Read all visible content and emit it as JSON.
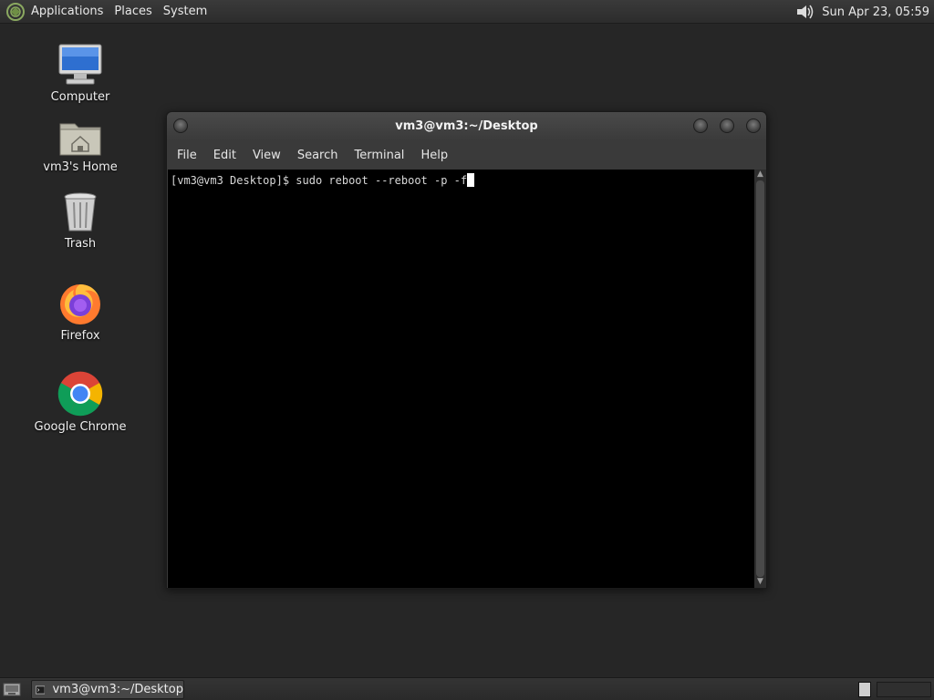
{
  "top_panel": {
    "menus": [
      "Applications",
      "Places",
      "System"
    ],
    "clock": "Sun Apr 23, 05:59",
    "icons": {
      "logo": "distro-logo-icon",
      "volume": "speaker-icon"
    }
  },
  "desktop": {
    "icons": [
      {
        "label": "Computer",
        "icon": "computer-icon"
      },
      {
        "label": "vm3's Home",
        "icon": "home-folder-icon"
      },
      {
        "label": "Trash",
        "icon": "trash-icon"
      },
      {
        "label": "Firefox",
        "icon": "firefox-icon"
      },
      {
        "label": "Google Chrome",
        "icon": "chrome-icon"
      }
    ]
  },
  "terminal_window": {
    "title": "vm3@vm3:~/Desktop",
    "menu": [
      "File",
      "Edit",
      "View",
      "Search",
      "Terminal",
      "Help"
    ],
    "prompt": "[vm3@vm3 Desktop]$ ",
    "command": "sudo reboot --reboot -p -f",
    "colors": {
      "background": "#000000",
      "text": "#d8d8d8"
    }
  },
  "bottom_panel": {
    "task_label": "vm3@vm3:~/Desktop",
    "icons": {
      "show_desktop": "show-desktop-icon",
      "task": "terminal-icon"
    }
  }
}
